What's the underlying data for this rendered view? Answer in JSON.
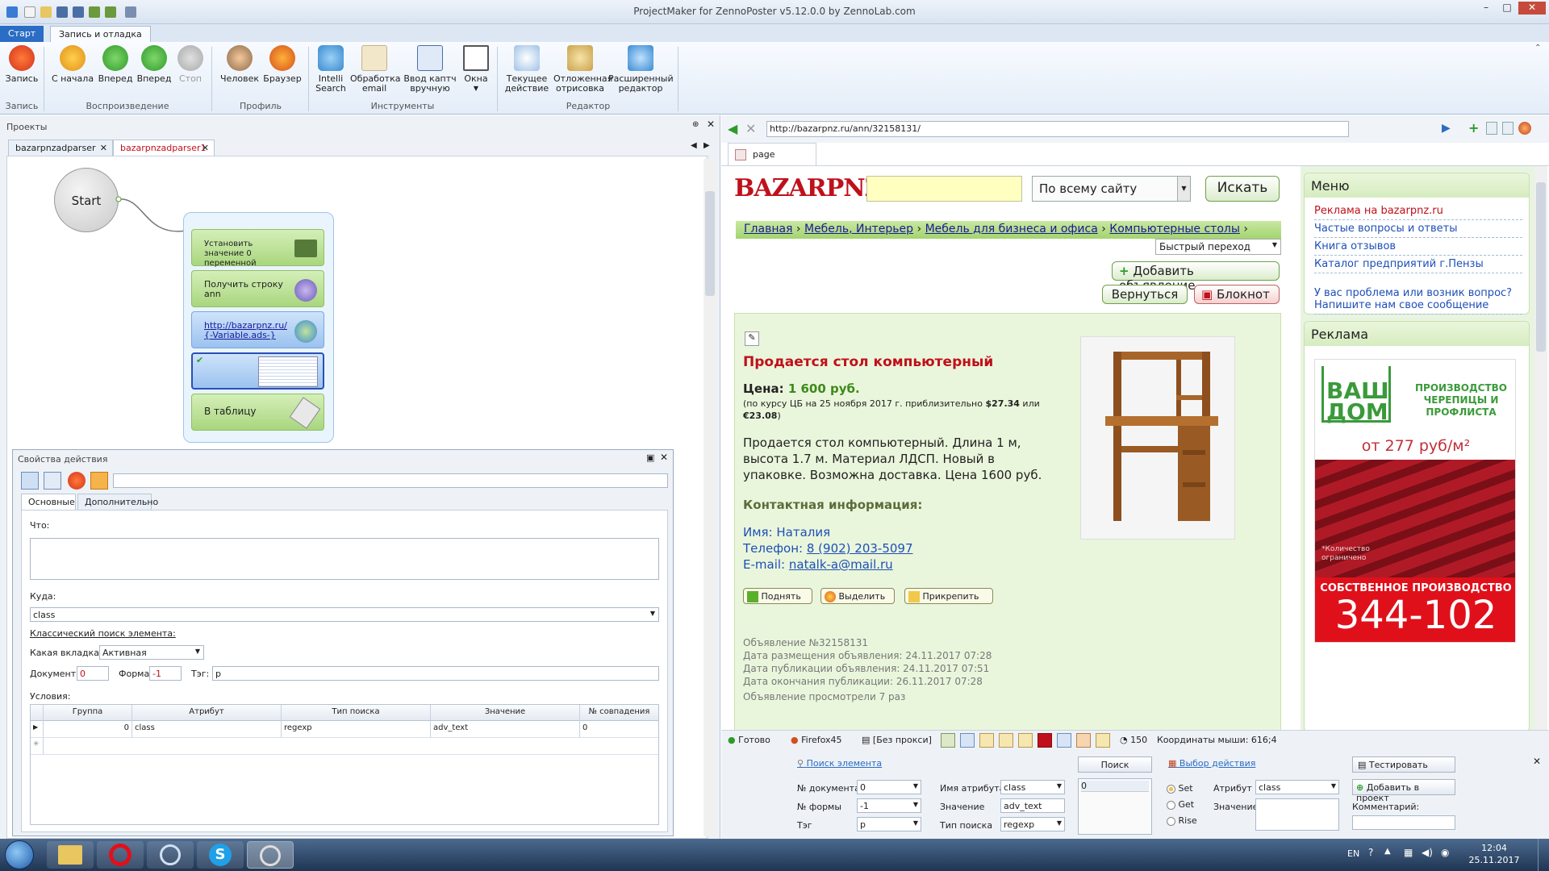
{
  "window": {
    "title": "ProjectMaker for ZennoPoster v5.12.0.0 by ZennoLab.com"
  },
  "ribbon": {
    "tabs": [
      "Старт",
      "Запись и отладка"
    ],
    "buttons": {
      "record": "Запись",
      "from_start": "С начала",
      "forward1": "Вперед",
      "forward2": "Вперед",
      "stop": "Стоп",
      "human": "Человек",
      "browser": "Браузер",
      "intelli": "Intelli Search",
      "email": "Обработка email",
      "captcha": "Ввод каптч вручную",
      "windows": "Окна",
      "current_action": "Текущее действие",
      "deferred_render": "Отложенная отрисовка",
      "advanced_editor": "Расширенный редактор"
    },
    "groups": {
      "record": "Запись",
      "playback": "Воспроизведение",
      "profile": "Профиль",
      "tools": "Инструменты",
      "editor": "Редактор"
    }
  },
  "projects": {
    "header": "Проекты",
    "tabs": [
      "bazarpnzadparser",
      "bazarpnzadparser1"
    ],
    "nodes": {
      "start": "Start",
      "set_value": "Установить значение 0 переменной",
      "get_string": "Получить строку ann",
      "url": "http://bazarpnz.ru/{-Variable.ads-}",
      "to_table": "В таблицу"
    }
  },
  "properties": {
    "header": "Свойства действия",
    "tabs": [
      "Основные",
      "Дополнительно"
    ],
    "what_label": "Что:",
    "where_label": "Куда:",
    "where_value": "class",
    "classic_search": "Классический поиск элемента:",
    "which_tab_label": "Какая вкладка:",
    "which_tab_value": "Активная",
    "document_label": "Документ:",
    "document_value": "0",
    "form_label": "Форма:",
    "form_value": "-1",
    "tag_label": "Тэг:",
    "tag_value": "p",
    "conditions_label": "Условия:",
    "grid_headers": [
      "Группа",
      "Атрибут",
      "Тип поиска",
      "Значение",
      "№ совпадения"
    ],
    "grid_row": [
      "0",
      "class",
      "regexp",
      "adv_text",
      "0"
    ]
  },
  "browser": {
    "url": "http://bazarpnz.ru/ann/32158131/",
    "tab": "page",
    "site": {
      "logo": "BAZARPNZ.RU",
      "search_scope": "По всему сайту",
      "search_button": "Искать",
      "breadcrumbs": [
        "Главная",
        "Мебель, Интерьер",
        "Мебель для бизнеса и офиса",
        "Компьютерные столы"
      ],
      "quick_nav": "Быстрый переход",
      "add_ad": "Добавить объявление",
      "back": "Вернуться",
      "notebook": "Блокнот",
      "ad_title": "Продается стол компьютерный",
      "price_label": "Цена:",
      "price_value": "1 600 руб.",
      "rate_note_prefix": "(по курсу ЦБ на 25 ноября 2017 г. приблизительно ",
      "rate_usd": "$27.34",
      "rate_mid": " или ",
      "rate_eur": "€23.08",
      "rate_close": ")",
      "description": "Продается стол компьютерный. Длина 1 м, высота 1.7 м. Материал ЛДСП. Новый в упаковке. Возможна доставка. Цена 1600 руб.",
      "contact_header": "Контактная информация:",
      "name_label": "Имя: Наталия",
      "phone_label": "Телефон:",
      "phone_value": "8 (902) 203-5097",
      "email_label": "E-mail:",
      "email_value": "natalk-a@mail.ru",
      "raise": "Поднять",
      "highlight": "Выделить",
      "pin": "Прикрепить",
      "meta": [
        "Объявление №32158131",
        "Дата размещения объявления: 24.11.2017  07:28",
        "Дата публикации объявления: 24.11.2017  07:51",
        "Дата окончания публикации: 26.11.2017 07:28",
        "Объявление просмотрели 7 раз"
      ],
      "menu_title": "Меню",
      "menu_items": [
        "Реклама на bazarpnz.ru",
        "Частые вопросы и ответы",
        "Книга отзывов",
        "Каталог предприятий г.Пензы"
      ],
      "menu_question": "У вас проблема или возник вопрос? Напишите нам свое сообщение",
      "ad_block_title": "Реклама",
      "banner": {
        "brand1": "ВАШ",
        "brand2": "ДОМ",
        "tagline": "ПРОИЗВОДСТВО ЧЕРЕПИЦЫ И ПРОФЛИСТА",
        "price": "от 277 руб/м²",
        "note": "*Количество ограничено",
        "production": "СОБСТВЕННОЕ ПРОИЗВОДСТВО",
        "phone": "344-102"
      }
    },
    "status": {
      "ready": "Готово",
      "browser": "Firefox45",
      "proxy": "[Без прокси]",
      "count": "150",
      "coords": "Координаты мыши: 616;4"
    }
  },
  "element_search": {
    "find_link": "Поиск элемента",
    "search_button": "Поиск",
    "choose_action": "Выбор действия",
    "test_button": "Тестировать",
    "doc_label": "№ документа",
    "doc_value": "0",
    "form_label": "№ формы",
    "form_value": "-1",
    "tag_label": "Тэг",
    "tag_value": "p",
    "attr_name_label": "Имя атрибута",
    "attr_name_value": "class",
    "value_label": "Значение",
    "value_value": "adv_text",
    "search_type_label": "Тип поиска",
    "search_type_value": "regexp",
    "result_value": "0",
    "radio_set": "Set",
    "radio_get": "Get",
    "radio_rise": "Rise",
    "attribute_label": "Атрибут",
    "attribute_value": "class",
    "value2_label": "Значение",
    "add_to_project": "Добавить в проект",
    "comment_label": "Комментарий:"
  },
  "taskbar": {
    "lang": "EN",
    "time": "12:04",
    "date": "25.11.2017"
  },
  "colors": {
    "accent_blue": "#2b6cc4",
    "site_green": "#5a8e2a",
    "site_red": "#c0101b"
  }
}
